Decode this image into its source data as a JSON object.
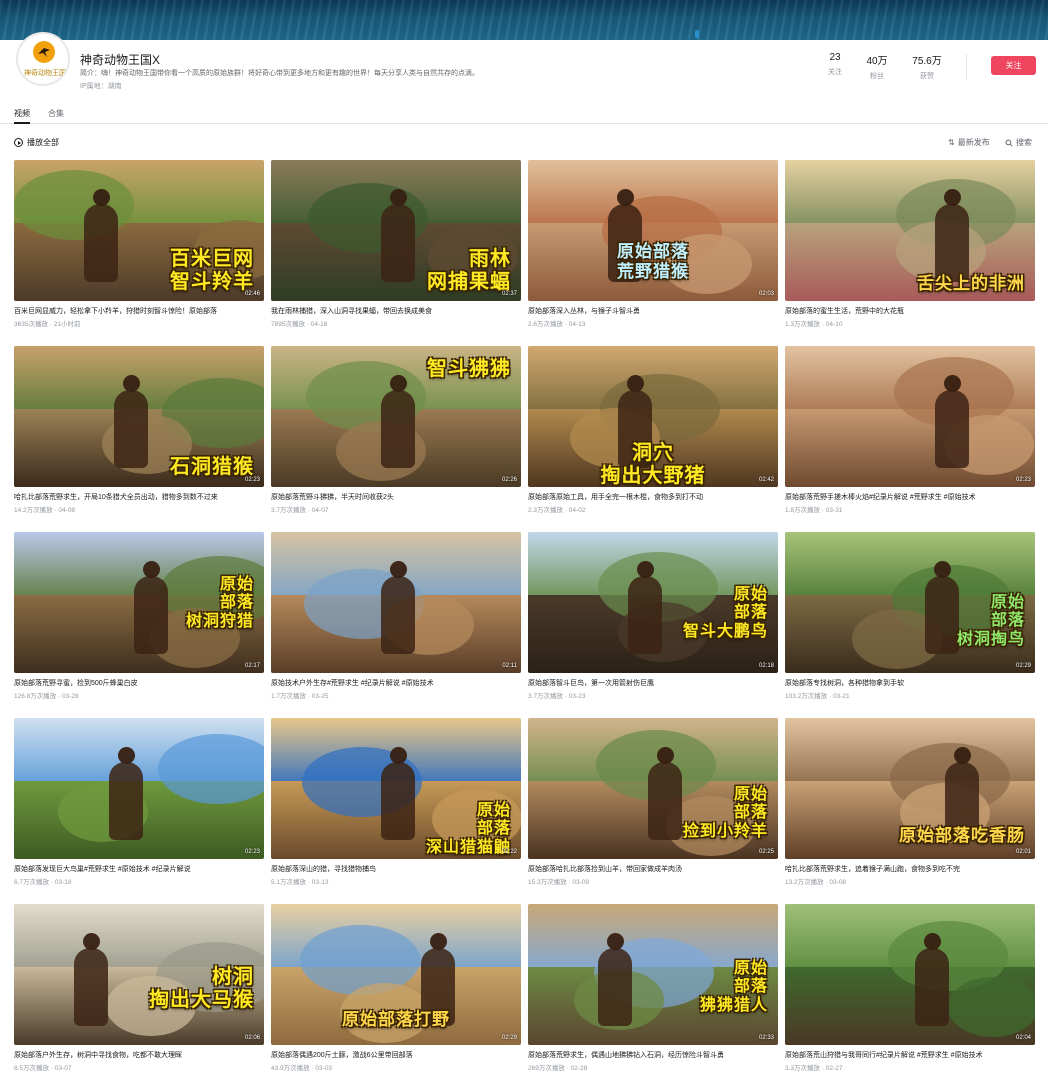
{
  "header": {
    "name": "神奇动物王国X",
    "avatar_text": "神奇动物王国",
    "desc": "简介：嗨！神奇动物王国带你看一个高质的原始族群！将好奇心带到更多地方和更有趣的世界！每天分享人类与自然共存的点滴。",
    "ip": "IP属地：湖南",
    "stats": [
      {
        "num": "23",
        "label": "关注"
      },
      {
        "num": "40万",
        "label": "粉丝"
      },
      {
        "num": "75.6万",
        "label": "获赞"
      }
    ],
    "follow_label": "关注"
  },
  "tabs": [
    {
      "label": "视频"
    },
    {
      "label": "合集"
    }
  ],
  "toolbar": {
    "play_all": "播放全部",
    "sort": "最新发布",
    "search": "搜索"
  },
  "videos": [
    {
      "caption": "百米巨网\n智斗羚羊",
      "duration": "02:46",
      "title": "百米巨网显威力，轻松拿下小羚羊，狩猎时刻智斗惊险！原始部落",
      "meta": "3635次播放 · 21小时前"
    },
    {
      "caption": "雨林\n网捕果蝠",
      "duration": "02:37",
      "title": "我在雨林捕猎，深入山洞寻找果蝠，带回去换成美食",
      "meta": "7895次播放 · 04-18"
    },
    {
      "caption": "原始部落\n荒野猎猴",
      "duration": "02:03",
      "title": "原始部落深入丛林，与猴子斗智斗勇",
      "meta": "2.6万次播放 · 04-13"
    },
    {
      "caption": "舌尖上的非洲",
      "duration": "",
      "title": "原始部落的蜜生生活，荒野中的大花瓶",
      "meta": "1.3万次播放 · 04-10"
    },
    {
      "caption": "石洞猎猴",
      "duration": "02:23",
      "title": "哈扎比部落荒野求生，开局10条猎犬全员出动，猎物多到数不过来",
      "meta": "14.2万次播放 · 04-08"
    },
    {
      "caption": "智斗狒狒",
      "duration": "02:26",
      "title": "原始部落荒野斗狒狒，半天时间收获2头",
      "meta": "3.7万次播放 · 04-07"
    },
    {
      "caption": "洞穴\n掏出大野猪",
      "duration": "02:42",
      "title": "原始部落原始工具，用手全完一根木棍，食物多到打不动",
      "meta": "2.3万次播放 · 04-02"
    },
    {
      "caption": "",
      "duration": "02:23",
      "title": "原始部落荒野手搓木棒火焰#纪录片解说 #荒野求生 #原始技术",
      "meta": "1.8万次播放 · 03-31"
    },
    {
      "caption": "原始\n部落\n树洞狩猎",
      "duration": "02:17",
      "title": "原始部落荒野寻蜜，捡到500斤蜂巢白皮",
      "meta": "126.8万次播放 · 03-28"
    },
    {
      "caption": "",
      "duration": "02:11",
      "title": "原始技术户外生存#荒野求生 #纪录片解说 #原始技术",
      "meta": "1.7万次播放 · 03-25"
    },
    {
      "caption": "原始\n部落\n智斗大鹏鸟",
      "duration": "02:18",
      "title": "原始部落智斗巨鸟，第一次用箭射伤巨鹰",
      "meta": "3.7万次播放 · 03-23"
    },
    {
      "caption": "原始\n部落\n树洞掏鸟",
      "duration": "02:29",
      "title": "原始部落专找树洞，各种猎物拿到手软",
      "meta": "103.2万次播放 · 03-21"
    },
    {
      "caption": "",
      "duration": "02:23",
      "title": "原始部落发现巨大鸟巢#荒野求生 #原始技术 #纪录片解说",
      "meta": "6.7万次播放 · 03-18"
    },
    {
      "caption": "原始\n部落\n深山猎猫鼬",
      "duration": "02:22",
      "title": "原始部落深山的猎，寻找猎物捕鸟",
      "meta": "5.1万次播放 · 03-13"
    },
    {
      "caption": "原始\n部落\n捡到小羚羊",
      "duration": "02:25",
      "title": "原始部落哈扎比部落捡到山羊，带回家做成羊肉汤",
      "meta": "15.3万次播放 · 03-09"
    },
    {
      "caption": "原始部落吃香肠",
      "duration": "02:01",
      "title": "哈扎比部落荒野求生，追着猴子满山跑，食物多到吃不完",
      "meta": "13.2万次播放 · 03-08"
    },
    {
      "caption": "树洞\n掏出大马猴",
      "duration": "02:06",
      "title": "原始部落户外生存，树洞中寻找食物，吃都不敢大理睬",
      "meta": "8.5万次播放 · 03-07"
    },
    {
      "caption": "原始部落打野",
      "duration": "02:29",
      "title": "原始部落偶遇200斤土豚，激战6公里带回部落",
      "meta": "43.9万次播放 · 03-03"
    },
    {
      "caption": "原始\n部落\n狒狒猎人",
      "duration": "02:33",
      "title": "原始部落荒野求生，偶遇山地狒狒钻入石洞，经历惊险斗智斗勇",
      "meta": "269万次播放 · 02-28"
    },
    {
      "caption": "",
      "duration": "02:04",
      "title": "原始部落荒山狩猎与我哥同行#纪录片解说 #荒野求生 #原始技术",
      "meta": "3.3万次播放 · 02-27"
    }
  ]
}
